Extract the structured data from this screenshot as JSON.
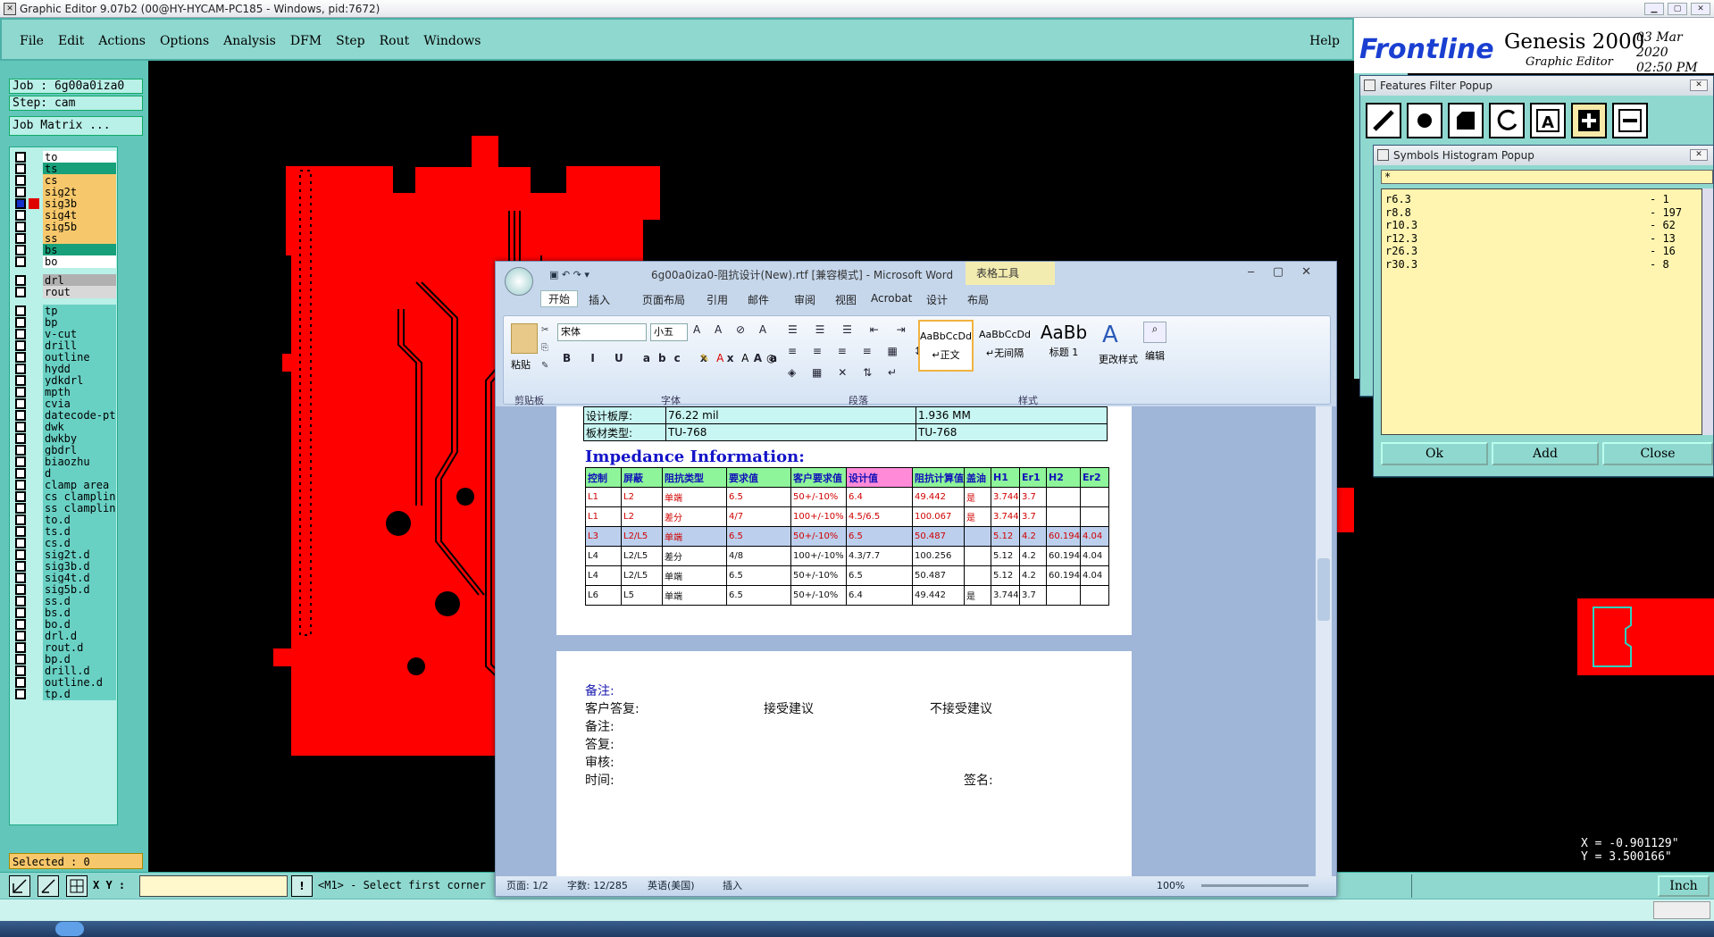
{
  "window": {
    "title": "Graphic Editor 9.07b2 (00@HY-HYCAM-PC185 - Windows, pid:7672)"
  },
  "menu": {
    "items": [
      "File",
      "Edit",
      "Actions",
      "Options",
      "Analysis",
      "DFM",
      "Step",
      "Rout",
      "Windows"
    ],
    "help": "Help"
  },
  "brand": {
    "logo_front": "Front",
    "logo_line": "line",
    "product": "Genesis 2000",
    "subtitle": "Graphic Editor",
    "date": "03 Mar 2020",
    "time": "02:50 PM"
  },
  "job": {
    "job": "Job : 6g00a0iza0",
    "step": "Step: cam",
    "matrix": "Job Matrix ..."
  },
  "layers": [
    {
      "name": "to",
      "color": "#ffffff",
      "mark": "",
      "on": false
    },
    {
      "name": "ts",
      "color": "#18a07a",
      "mark": "",
      "on": false
    },
    {
      "name": "cs",
      "color": "#f7c86b",
      "mark": "",
      "on": false
    },
    {
      "name": "sig2t",
      "color": "#f7c86b",
      "mark": "",
      "on": false
    },
    {
      "name": "sig3b",
      "color": "#f7c86b",
      "mark": "#e00000",
      "on": true
    },
    {
      "name": "sig4t",
      "color": "#f7c86b",
      "mark": "",
      "on": false
    },
    {
      "name": "sig5b",
      "color": "#f7c86b",
      "mark": "",
      "on": false
    },
    {
      "name": "ss",
      "color": "#f7c86b",
      "mark": "",
      "on": false
    },
    {
      "name": "bs",
      "color": "#18a07a",
      "mark": "",
      "on": false
    },
    {
      "name": "bo",
      "color": "#ffffff",
      "mark": "",
      "on": false
    },
    {
      "name": "drl",
      "color": "#b0b0b0",
      "mark": "",
      "on": false
    },
    {
      "name": "rout",
      "color": "#d8d8d8",
      "mark": "",
      "on": false
    },
    {
      "name": "tp",
      "color": "#69d1c4",
      "mark": "",
      "on": false
    },
    {
      "name": "bp",
      "color": "#69d1c4",
      "mark": "",
      "on": false
    },
    {
      "name": "v-cut",
      "color": "#69d1c4",
      "mark": "",
      "on": false
    },
    {
      "name": "drill",
      "color": "#69d1c4",
      "mark": "",
      "on": false
    },
    {
      "name": "outline",
      "color": "#69d1c4",
      "mark": "",
      "on": false
    },
    {
      "name": "hydd",
      "color": "#69d1c4",
      "mark": "",
      "on": false
    },
    {
      "name": "ydkdrl",
      "color": "#69d1c4",
      "mark": "",
      "on": false
    },
    {
      "name": "mpth",
      "color": "#69d1c4",
      "mark": "",
      "on": false
    },
    {
      "name": "cvia",
      "color": "#69d1c4",
      "mark": "",
      "on": false
    },
    {
      "name": "datecode-pt",
      "color": "#69d1c4",
      "mark": "",
      "on": false
    },
    {
      "name": "dwk",
      "color": "#69d1c4",
      "mark": "",
      "on": false
    },
    {
      "name": "dwkby",
      "color": "#69d1c4",
      "mark": "",
      "on": false
    },
    {
      "name": "gbdrl",
      "color": "#69d1c4",
      "mark": "",
      "on": false
    },
    {
      "name": "biaozhu",
      "color": "#69d1c4",
      "mark": "",
      "on": false
    },
    {
      "name": "d",
      "color": "#69d1c4",
      "mark": "",
      "on": false
    },
    {
      "name": "clamp_area",
      "color": "#69d1c4",
      "mark": "",
      "on": false
    },
    {
      "name": "cs_clampline",
      "color": "#69d1c4",
      "mark": "",
      "on": false
    },
    {
      "name": "ss_clampline",
      "color": "#69d1c4",
      "mark": "",
      "on": false
    },
    {
      "name": "to.d",
      "color": "#69d1c4",
      "mark": "",
      "on": false
    },
    {
      "name": "ts.d",
      "color": "#69d1c4",
      "mark": "",
      "on": false
    },
    {
      "name": "cs.d",
      "color": "#69d1c4",
      "mark": "",
      "on": false
    },
    {
      "name": "sig2t.d",
      "color": "#69d1c4",
      "mark": "",
      "on": false
    },
    {
      "name": "sig3b.d",
      "color": "#69d1c4",
      "mark": "",
      "on": false
    },
    {
      "name": "sig4t.d",
      "color": "#69d1c4",
      "mark": "",
      "on": false
    },
    {
      "name": "sig5b.d",
      "color": "#69d1c4",
      "mark": "",
      "on": false
    },
    {
      "name": "ss.d",
      "color": "#69d1c4",
      "mark": "",
      "on": false
    },
    {
      "name": "bs.d",
      "color": "#69d1c4",
      "mark": "",
      "on": false
    },
    {
      "name": "bo.d",
      "color": "#69d1c4",
      "mark": "",
      "on": false
    },
    {
      "name": "drl.d",
      "color": "#69d1c4",
      "mark": "",
      "on": false
    },
    {
      "name": "rout.d",
      "color": "#69d1c4",
      "mark": "",
      "on": false
    },
    {
      "name": "bp.d",
      "color": "#69d1c4",
      "mark": "",
      "on": false
    },
    {
      "name": "drill.d",
      "color": "#69d1c4",
      "mark": "",
      "on": false
    },
    {
      "name": "outline.d",
      "color": "#69d1c4",
      "mark": "",
      "on": false
    },
    {
      "name": "tp.d",
      "color": "#69d1c4",
      "mark": "",
      "on": false
    }
  ],
  "selected": "Selected : 0",
  "bottom": {
    "xy_label": "X Y :",
    "xy_value": "",
    "prompt": "<M1> - Select first corner",
    "units": "Inch"
  },
  "coords": {
    "x": "X = -0.901129\"",
    "y": "Y = 3.500166\""
  },
  "features_popup": {
    "title": "Features Filter Popup"
  },
  "histogram": {
    "title": "Symbols Histogram Popup",
    "filter": "*",
    "rows": [
      {
        "sym": "r6.3",
        "count": "- 1"
      },
      {
        "sym": "r8.8",
        "count": "- 197"
      },
      {
        "sym": "r10.3",
        "count": "- 62"
      },
      {
        "sym": "r12.3",
        "count": "- 13"
      },
      {
        "sym": "r26.3",
        "count": "- 16"
      },
      {
        "sym": "r30.3",
        "count": "- 8"
      }
    ],
    "buttons": {
      "ok": "Ok",
      "add": "Add",
      "close": "Close"
    }
  },
  "word": {
    "title": "6g00a0iza0-阻抗设计(New).rtf [兼容模式] - Microsoft Word",
    "table_tools": "表格工具",
    "tabs": [
      "开始",
      "插入",
      "页面布局",
      "引用",
      "邮件",
      "审阅",
      "视图",
      "Acrobat",
      "设计",
      "布局"
    ],
    "font_name": "宋体",
    "font_size": "小五",
    "paste": "粘贴",
    "clipboard": "剪贴板",
    "font_group": "字体",
    "para_group": "段落",
    "style_group": "样式",
    "styles": [
      {
        "sample": "AaBbCcDd",
        "name": "↵正文"
      },
      {
        "sample": "AaBbCcDd",
        "name": "↵无间隔"
      },
      {
        "sample": "AaBb",
        "name": "标题 1"
      }
    ],
    "change_style": "更改样式",
    "edit": "编辑",
    "info_rows": [
      [
        "设计板厚:",
        "76.22 mil",
        "1.936 MM"
      ],
      [
        "板材类型:",
        "TU-768",
        "TU-768"
      ]
    ],
    "impedance_title": "Impedance Information:",
    "imp_header": [
      "控制",
      "屏蔽",
      "阻抗类型",
      "要求值",
      "客户要求值",
      "设计值",
      "阻抗计算值",
      "盖油",
      "H1",
      "Er1",
      "H2",
      "Er2"
    ],
    "imp_rows": [
      [
        "L1",
        "L2",
        "单端",
        "6.5",
        "50+/-10%",
        "6.4",
        "49.442",
        "是",
        "3.744",
        "3.7",
        "",
        ""
      ],
      [
        "L1",
        "L2",
        "差分",
        "4/7",
        "100+/-10%",
        "4.5/6.5",
        "100.067",
        "是",
        "3.744",
        "3.7",
        "",
        ""
      ],
      [
        "L3",
        "L2/L5",
        "单端",
        "6.5",
        "50+/-10%",
        "6.5",
        "50.487",
        "",
        "5.12",
        "4.2",
        "60.194",
        "4.04"
      ],
      [
        "L4",
        "L2/L5",
        "差分",
        "4/8",
        "100+/-10%",
        "4.3/7.7",
        "100.256",
        "",
        "5.12",
        "4.2",
        "60.194",
        "4.04"
      ],
      [
        "L4",
        "L2/L5",
        "单端",
        "6.5",
        "50+/-10%",
        "6.5",
        "50.487",
        "",
        "5.12",
        "4.2",
        "60.194",
        "4.04"
      ],
      [
        "L6",
        "L5",
        "单端",
        "6.5",
        "50+/-10%",
        "6.4",
        "49.442",
        "是",
        "3.744",
        "3.7",
        "",
        ""
      ]
    ],
    "notes": {
      "remark": "备注:",
      "client_reply": "客户答复:",
      "accept": "接受建议",
      "reject": "不接受建议",
      "remark2": "备注:",
      "answer": "答复:",
      "review": "审核:",
      "time": "时间:",
      "sign": "签名:"
    },
    "status": {
      "page": "页面: 1/2",
      "words": "字数: 12/285",
      "lang": "英语(美国)",
      "mode": "插入",
      "zoom": "100%"
    }
  }
}
